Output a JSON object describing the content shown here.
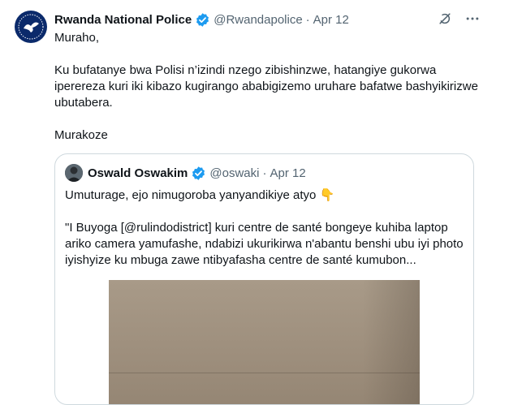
{
  "tweet": {
    "author_name": "Rwanda National Police",
    "author_handle": "@Rwandapolice",
    "separator": "·",
    "date": "Apr 12",
    "paragraphs": [
      "Muraho,",
      "Ku bufatanye bwa Polisi n’izindi nzego zibishinzwe, hatangiye gukorwa iperereza kuri iki kibazo kugirango ababigizemo uruhare bafatwe bashyikirizwe ubutabera.",
      "Murakoze"
    ],
    "icons": {
      "avatar": "police-emblem-icon",
      "verified": "verified-badge-icon",
      "grok": "grok-icon",
      "more": "more-icon"
    },
    "colors": {
      "verified": "#1d9bf0",
      "secondary_text": "#536471",
      "border": "#cfd9de"
    }
  },
  "quote": {
    "author_name": "Oswald Oswakim",
    "author_handle": "@oswaki",
    "separator": "·",
    "date": "Apr 12",
    "line1": "Umuturage, ejo nimugoroba yanyandikiye atyo",
    "line1_emoji": "👇",
    "line2": "\"I Buyoga [@rulindodistrict] kuri centre de santé bongeye kuhiba laptop ariko camera yamufashe, ndabizi ukurikirwa n'abantu benshi ubu iyi photo iyishyize ku mbuga zawe ntibyafasha centre de santé kumubon...",
    "icons": {
      "avatar": "user-avatar-icon",
      "verified": "verified-badge-icon"
    }
  }
}
